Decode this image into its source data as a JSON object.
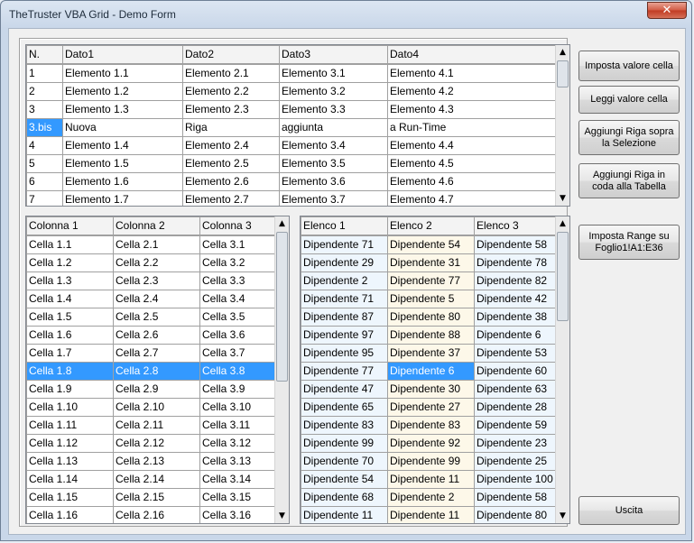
{
  "window": {
    "title": "TheTruster VBA Grid - Demo Form",
    "close_glyph": "✕"
  },
  "buttons": {
    "imposta_valore": "Imposta valore cella",
    "leggi_valore": "Leggi valore cella",
    "aggiungi_sopra": "Aggiungi Riga sopra la Selezione",
    "aggiungi_coda": "Aggiungi Riga in coda alla Tabella",
    "imposta_range": "Imposta Range su Foglio1!A1:E36",
    "uscita": "Uscita"
  },
  "scroll_glyphs": {
    "up": "▲",
    "down": "▼"
  },
  "grid1": {
    "headers": [
      "N.",
      "Dato1",
      "Dato2",
      "Dato3",
      "Dato4"
    ],
    "rows": [
      [
        "1",
        "Elemento 1.1",
        "Elemento 2.1",
        "Elemento 3.1",
        "Elemento 4.1"
      ],
      [
        "2",
        "Elemento 1.2",
        "Elemento 2.2",
        "Elemento 3.2",
        "Elemento 4.2"
      ],
      [
        "3",
        "Elemento 1.3",
        "Elemento 2.3",
        "Elemento 3.3",
        "Elemento 4.3"
      ],
      [
        "3.bis",
        "Nuova",
        "Riga",
        "aggiunta",
        "a Run-Time"
      ],
      [
        "4",
        "Elemento 1.4",
        "Elemento 2.4",
        "Elemento 3.4",
        "Elemento 4.4"
      ],
      [
        "5",
        "Elemento 1.5",
        "Elemento 2.5",
        "Elemento 3.5",
        "Elemento 4.5"
      ],
      [
        "6",
        "Elemento 1.6",
        "Elemento 2.6",
        "Elemento 3.6",
        "Elemento 4.6"
      ],
      [
        "7",
        "Elemento 1.7",
        "Elemento 2.7",
        "Elemento 3.7",
        "Elemento 4.7"
      ]
    ]
  },
  "grid2": {
    "headers": [
      "Colonna 1",
      "Colonna 2",
      "Colonna 3"
    ],
    "rows": [
      [
        "Cella 1.1",
        "Cella 2.1",
        "Cella 3.1"
      ],
      [
        "Cella 1.2",
        "Cella 2.2",
        "Cella 3.2"
      ],
      [
        "Cella 1.3",
        "Cella 2.3",
        "Cella 3.3"
      ],
      [
        "Cella 1.4",
        "Cella 2.4",
        "Cella 3.4"
      ],
      [
        "Cella 1.5",
        "Cella 2.5",
        "Cella 3.5"
      ],
      [
        "Cella 1.6",
        "Cella 2.6",
        "Cella 3.6"
      ],
      [
        "Cella 1.7",
        "Cella 2.7",
        "Cella 3.7"
      ],
      [
        "Cella 1.8",
        "Cella 2.8",
        "Cella 3.8"
      ],
      [
        "Cella 1.9",
        "Cella 2.9",
        "Cella 3.9"
      ],
      [
        "Cella 1.10",
        "Cella 2.10",
        "Cella 3.10"
      ],
      [
        "Cella 1.11",
        "Cella 2.11",
        "Cella 3.11"
      ],
      [
        "Cella 1.12",
        "Cella 2.12",
        "Cella 3.12"
      ],
      [
        "Cella 1.13",
        "Cella 2.13",
        "Cella 3.13"
      ],
      [
        "Cella 1.14",
        "Cella 2.14",
        "Cella 3.14"
      ],
      [
        "Cella 1.15",
        "Cella 2.15",
        "Cella 3.15"
      ],
      [
        "Cella 1.16",
        "Cella 2.16",
        "Cella 3.16"
      ]
    ]
  },
  "grid3": {
    "headers": [
      "Elenco 1",
      "Elenco 2",
      "Elenco 3"
    ],
    "rows": [
      [
        "Dipendente 71",
        "Dipendente 54",
        "Dipendente 58"
      ],
      [
        "Dipendente 29",
        "Dipendente 31",
        "Dipendente 78"
      ],
      [
        "Dipendente 2",
        "Dipendente 77",
        "Dipendente 82"
      ],
      [
        "Dipendente 71",
        "Dipendente 5",
        "Dipendente 42"
      ],
      [
        "Dipendente 87",
        "Dipendente 80",
        "Dipendente 38"
      ],
      [
        "Dipendente 97",
        "Dipendente 88",
        "Dipendente 6"
      ],
      [
        "Dipendente 95",
        "Dipendente 37",
        "Dipendente 53"
      ],
      [
        "Dipendente 77",
        "Dipendente 6",
        "Dipendente 60"
      ],
      [
        "Dipendente 47",
        "Dipendente 30",
        "Dipendente 63"
      ],
      [
        "Dipendente 65",
        "Dipendente 27",
        "Dipendente 28"
      ],
      [
        "Dipendente 83",
        "Dipendente 83",
        "Dipendente 59"
      ],
      [
        "Dipendente 99",
        "Dipendente 92",
        "Dipendente 23"
      ],
      [
        "Dipendente 70",
        "Dipendente 99",
        "Dipendente 25"
      ],
      [
        "Dipendente 54",
        "Dipendente 11",
        "Dipendente 100"
      ],
      [
        "Dipendente 68",
        "Dipendente 2",
        "Dipendente 58"
      ],
      [
        "Dipendente 11",
        "Dipendente 11",
        "Dipendente 80"
      ]
    ]
  },
  "colors": {
    "selection": "#3399ff",
    "band_yellow": "#fdf8e9",
    "band_blue": "#eef6fd",
    "close": "#c9462c"
  }
}
